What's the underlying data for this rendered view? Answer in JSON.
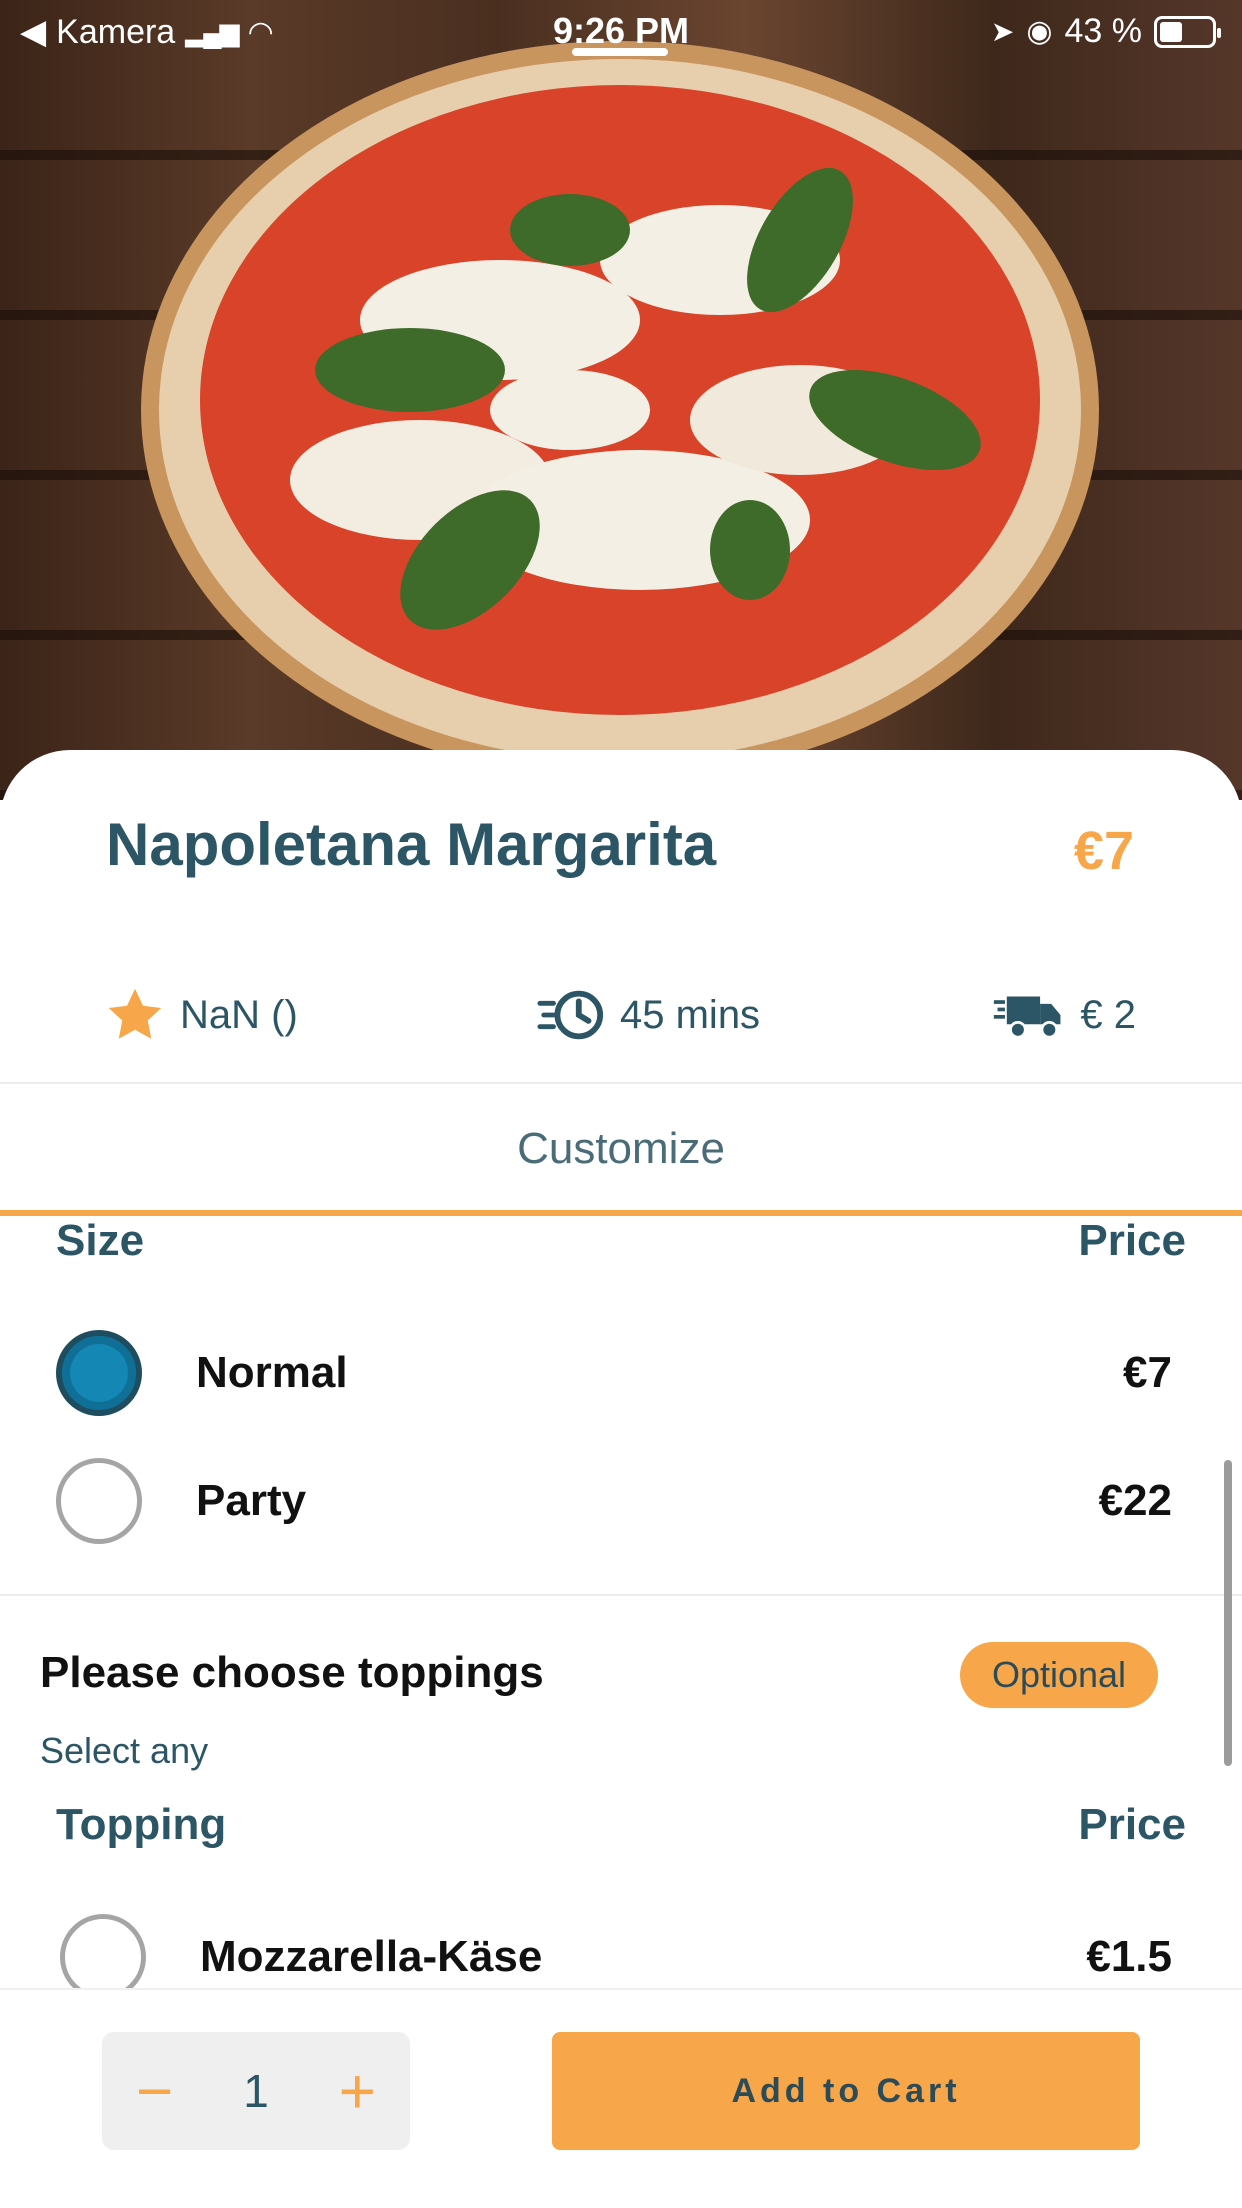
{
  "status_bar": {
    "back_app": "Kamera",
    "time": "9:26 PM",
    "battery": "43 %"
  },
  "product": {
    "name": "Napoletana Margarita",
    "price": "€7",
    "rating": "NaN ()",
    "time": "45 mins",
    "delivery": "€ 2"
  },
  "tabs": {
    "customize": "Customize"
  },
  "size_section": {
    "col_name": "Size",
    "col_price": "Price",
    "options": [
      {
        "label": "Normal",
        "price": "€7",
        "selected": true
      },
      {
        "label": "Party",
        "price": "€22",
        "selected": false
      }
    ]
  },
  "toppings_section": {
    "title": "Please choose toppings",
    "badge": "Optional",
    "subtitle": "Select any",
    "col_name": "Topping",
    "col_price": "Price",
    "options": [
      {
        "label": "Mozzarella-Käse",
        "price": "€1.5",
        "selected": false
      }
    ]
  },
  "cart": {
    "quantity": "1",
    "minus": "−",
    "plus": "+",
    "add_label": "Add to Cart"
  },
  "colors": {
    "accent": "#f7a649",
    "primary_text": "#2c5566",
    "radio_selected": "#1487b5"
  }
}
